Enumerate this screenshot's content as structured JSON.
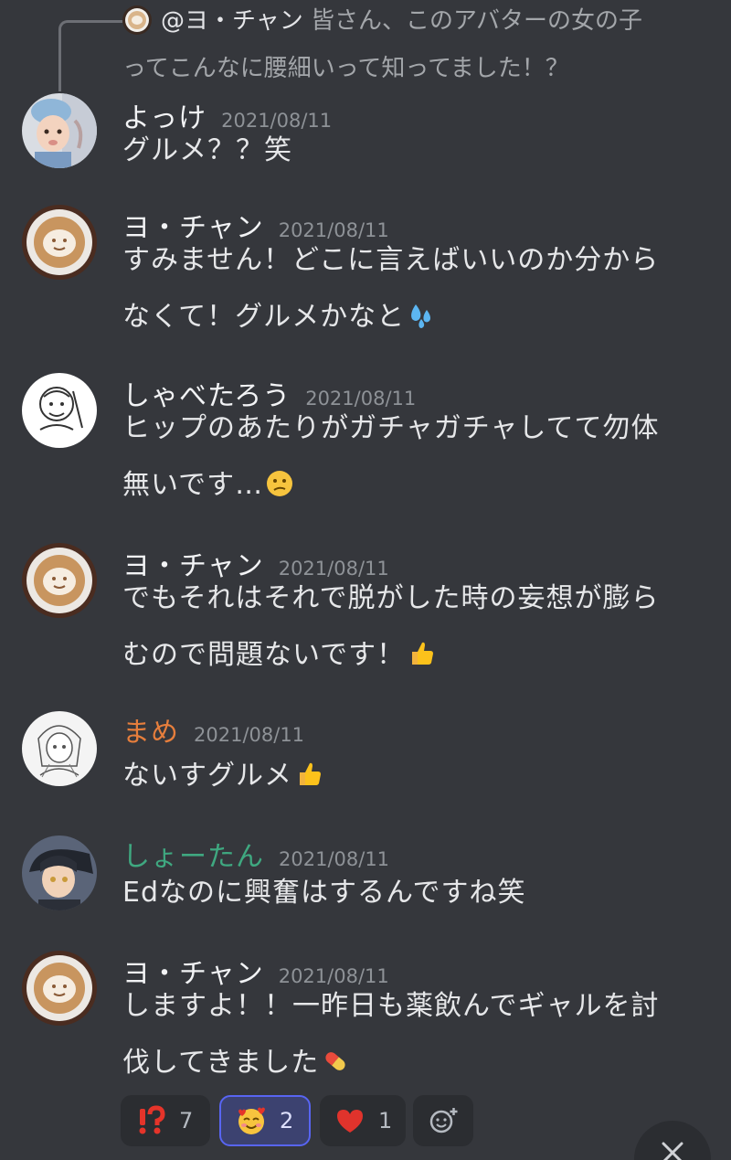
{
  "reply": {
    "author": "@ヨ・チャン",
    "text_line1": " 皆さん、このアバターの女の子",
    "text_line2": "ってこんなに腰細いって知ってました！？"
  },
  "messages": [
    {
      "author": "よっけ",
      "author_color": "#f2f3f5",
      "timestamp": "2021/08/11",
      "avatar": "child-photo-avatar",
      "lines": [
        "グルメ？？笑"
      ]
    },
    {
      "author": "ヨ・チャン",
      "author_color": "#f2f3f5",
      "timestamp": "2021/08/11",
      "avatar": "latte-art-avatar",
      "lines": [
        "すみません！どこに言えばいいのか分から",
        "なくて！グルメかなと"
      ],
      "emoji": "sweat-droplets-emoji"
    },
    {
      "author": "しゃべたろう",
      "author_color": "#f2f3f5",
      "timestamp": "2021/08/11",
      "avatar": "sketch-character-avatar",
      "lines": [
        "ヒップのあたりがガチャガチャしてて勿体",
        "無いです…"
      ],
      "emoji": "confused-face-emoji"
    },
    {
      "author": "ヨ・チャン",
      "author_color": "#f2f3f5",
      "timestamp": "2021/08/11",
      "avatar": "latte-art-avatar",
      "lines": [
        "でもそれはそれで脱がした時の妄想が膨ら",
        "むので問題ないです！"
      ],
      "emoji": "thumbs-up-emoji"
    },
    {
      "author": "まめ",
      "author_color": "#e67e3c",
      "timestamp": "2021/08/11",
      "avatar": "anime-girl-sketch-avatar",
      "lines": [
        "ないすグルメ"
      ],
      "emoji": "thumbs-up-emoji"
    },
    {
      "author": "しょーたん",
      "author_color": "#3fa880",
      "timestamp": "2021/08/11",
      "avatar": "anime-boy-avatar",
      "lines": [
        "Edなのに興奮はするんですね笑"
      ]
    },
    {
      "author": "ヨ・チャン",
      "author_color": "#f2f3f5",
      "timestamp": "2021/08/11",
      "avatar": "latte-art-avatar",
      "lines": [
        "しますよ！！一昨日も薬飲んでギャルを討",
        "伐してきました"
      ],
      "emoji": "pill-emoji"
    }
  ],
  "reactions": [
    {
      "emoji": "interrobang-emoji",
      "count": "7",
      "active": false
    },
    {
      "emoji": "smiling-face-with-hearts-emoji",
      "count": "2",
      "active": true
    },
    {
      "emoji": "red-heart-emoji",
      "count": "1",
      "active": false
    }
  ],
  "add_reaction_icon": "add-reaction-icon",
  "jump_button_icon": "close-icon",
  "colors": {
    "background": "#35373c",
    "accent": "#5865f2",
    "timestamp": "#8e9297"
  }
}
